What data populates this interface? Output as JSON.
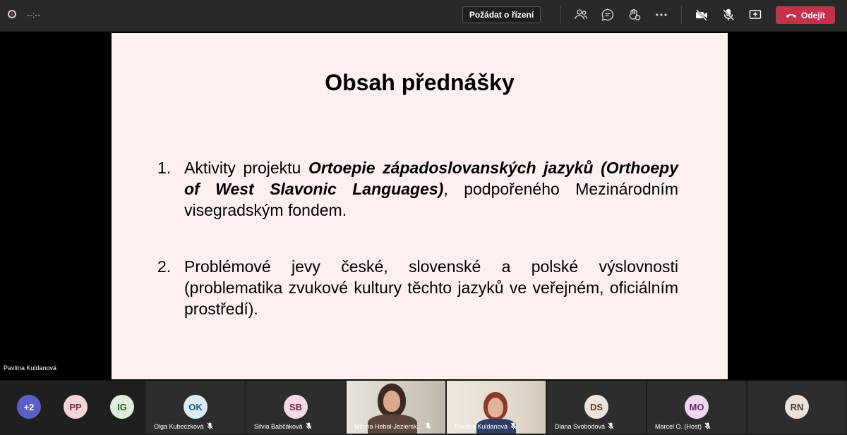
{
  "topbar": {
    "timer": "--:--",
    "request_control": "Požádat o řízení",
    "leave": "Odejít",
    "icons": [
      "participants-icon",
      "chat-icon",
      "reactions-icon",
      "more-icon",
      "camera-off-icon",
      "mic-off-icon",
      "share-icon",
      "phone-icon"
    ]
  },
  "slide": {
    "title": "Obsah přednášky",
    "item1_num": "1.",
    "item1_pre": "Aktivity projektu ",
    "item1_bold": "Ortoepie západoslovanských jazyků (Orthoepy of West Slavonic Languages)",
    "item1_post": ", podpořeného Mezinárodním visegradským fondem.",
    "item2_num": "2.",
    "item2_text": "Problémové jevy české, slovenské a polské výslovnosti (problematika zvukové kultury těchto jazyků ve veřejném, oficiálním prostředí)."
  },
  "presenter_name": "Pavlína Kuldanová",
  "gallery": {
    "overflow": {
      "label": "+2",
      "color": "#5b5fc7"
    },
    "small_avatars": [
      {
        "initials": "PP",
        "color": "#f2d5d8",
        "text_color": "#7a2e3a"
      },
      {
        "initials": "IG",
        "color": "#dfecd9",
        "text_color": "#2f5a23"
      }
    ],
    "tiles": [
      {
        "initials": "OK",
        "name": "Olga Kubeczková",
        "color": "#dcecf5",
        "text_color": "#1f5c7a"
      },
      {
        "initials": "SB",
        "name": "Silvia Babčáková",
        "color": "#f5d9e6",
        "text_color": "#7a1f45"
      },
      {
        "initials": "",
        "name": "Milena Hebal-Jeziersk...",
        "color": "",
        "text_color": ""
      },
      {
        "initials": "",
        "name": "Pavlína Kuldanová",
        "color": "",
        "text_color": ""
      },
      {
        "initials": "DS",
        "name": "Diana Svobodová",
        "color": "#efe4dc",
        "text_color": "#5a4030"
      },
      {
        "initials": "MO",
        "name": "Marcel O. (Host)",
        "color": "#efd9ef",
        "text_color": "#6a2a6a"
      },
      {
        "initials": "RN",
        "name": "",
        "color": "#ece2da",
        "text_color": "#4a3a30"
      }
    ]
  }
}
